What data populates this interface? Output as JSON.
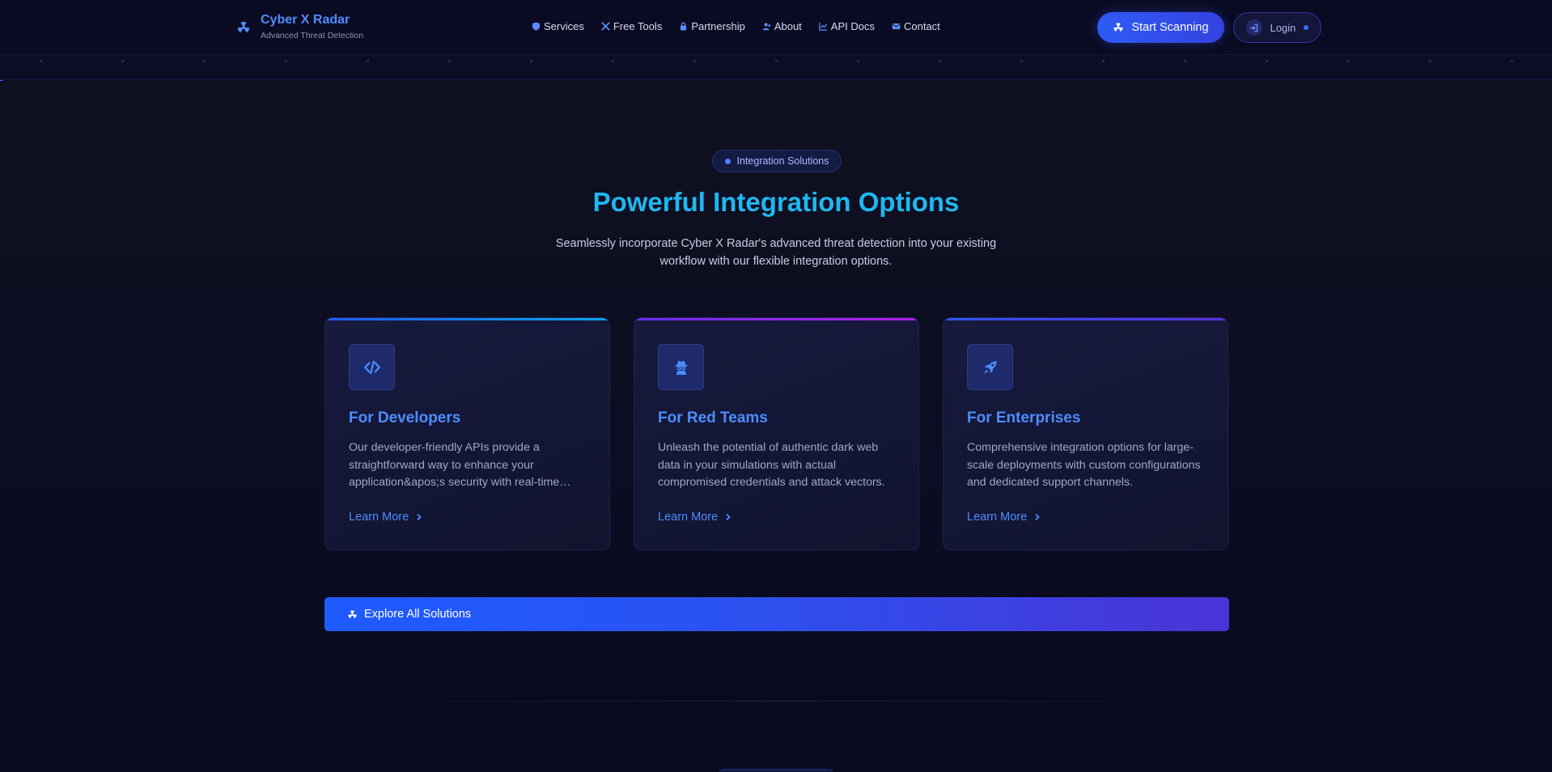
{
  "header": {
    "brand_name": "Cyber X Radar",
    "brand_tagline": "Advanced Threat Detection",
    "nav": [
      {
        "label": "Services",
        "icon": "shield-icon"
      },
      {
        "label": "Free Tools",
        "icon": "tools-icon"
      },
      {
        "label": "Partnership",
        "icon": "lock-icon"
      },
      {
        "label": "About",
        "icon": "users-icon"
      },
      {
        "label": "API Docs",
        "icon": "chart-icon"
      },
      {
        "label": "Contact",
        "icon": "envelope-icon"
      }
    ],
    "scan_button": "Start Scanning",
    "login_button": "Login"
  },
  "section": {
    "badge": "Integration Solutions",
    "title": "Powerful Integration Options",
    "subtitle": "Seamlessly incorporate Cyber X Radar's advanced threat detection into your existing workflow with our flexible integration options."
  },
  "cards": [
    {
      "title": "For Developers",
      "text": "Our developer-friendly APIs provide a straightforward way to enhance your application&apos;s security with real-time threat intelligence.",
      "link": "Learn More",
      "icon": "code-icon",
      "accent": "#1f6bff"
    },
    {
      "title": "For Red Teams",
      "text": "Unleash the potential of authentic dark web data in your simulations with actual compromised credentials and attack vectors.",
      "link": "Learn More",
      "icon": "spy-icon",
      "accent": "#8a25f0"
    },
    {
      "title": "For Enterprises",
      "text": "Comprehensive integration options for large-scale deployments with custom configurations and dedicated support channels.",
      "link": "Learn More",
      "icon": "rocket-icon",
      "accent": "#3d3af0"
    }
  ],
  "explore_button": "Explore All Solutions",
  "colors": {
    "background": "#090a1e",
    "accent_blue": "#4c8dff",
    "title_cyan": "#1fb7f0"
  }
}
